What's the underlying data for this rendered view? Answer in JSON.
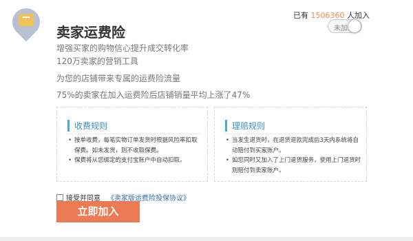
{
  "header": {
    "title": "卖家运费险",
    "join_prefix": "已有",
    "join_count": "1506360",
    "join_suffix": "人加入",
    "toggle_label": "未加入"
  },
  "features": [
    "增强买家的购物信心提升成交转化率",
    "120万卖家的营销工具",
    "为您的店铺带来专属的运费险流量",
    "75%的卖家在加入运费险后店铺销量平均上涨了47%"
  ],
  "fee_rules": {
    "title": "收费规则",
    "items": [
      "按单收费，每笔实物订单发货时根据风险率扣取保费。如未发货，则不收取保费。",
      "保费将从您绑定的支付宝账户中自动扣取。"
    ]
  },
  "claim_rules": {
    "title": "理赔规则",
    "items": [
      "当发生退货时，在退货退款完成后3天内系统将自动赔付到买家账户。",
      "如您同时又加入了上门退货服务，使用上门退货时则赔付到卖家账户。"
    ]
  },
  "agreement": {
    "label": "接受并同意",
    "link": "《卖家版运费险投保协议》"
  },
  "join_button": "立即加入",
  "colors": {
    "accent_orange": "#ec7a54",
    "count_orange": "#f08a4b",
    "rule_blue": "#3a8fc4",
    "link_blue": "#2d6fb0"
  },
  "icons": {
    "badge": "box-location-pin-icon"
  }
}
